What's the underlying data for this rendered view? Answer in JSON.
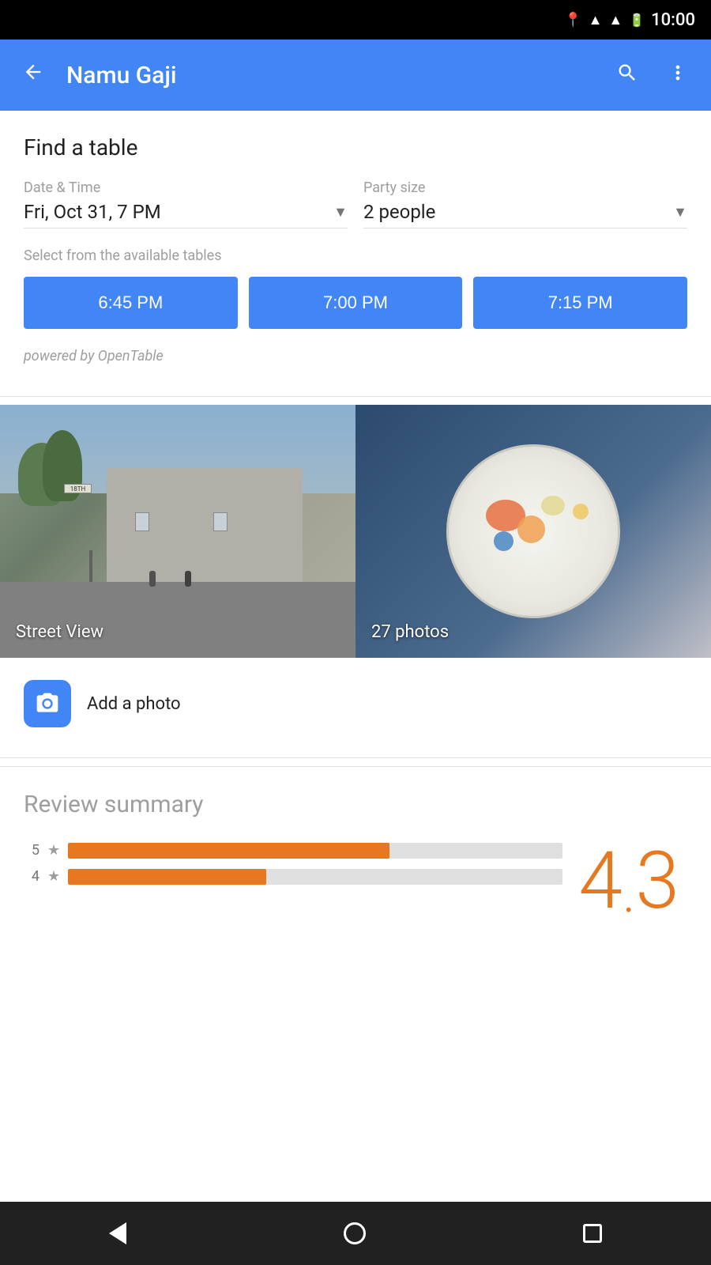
{
  "statusBar": {
    "time": "10:00"
  },
  "appBar": {
    "title": "Namu Gaji",
    "backLabel": "←",
    "searchLabel": "🔍",
    "moreLabel": "⋮"
  },
  "findTable": {
    "title": "Find a table",
    "dateTimeLabel": "Date & Time",
    "dateTimeValue": "Fri, Oct 31, 7 PM",
    "partySizeLabel": "Party size",
    "partySizeValue": "2 people",
    "availableLabel": "Select from the available tables",
    "timeSlots": [
      "6:45 PM",
      "7:00 PM",
      "7:15 PM"
    ],
    "poweredBy": "powered by OpenTable"
  },
  "photos": {
    "streetViewLabel": "Street View",
    "photosLabel": "27 photos",
    "addPhotoLabel": "Add a photo"
  },
  "reviewSummary": {
    "title": "Review summary",
    "rating": "4",
    "ratingDecimal": ".",
    "ratingFraction": "3",
    "bars": [
      {
        "stars": "5",
        "fillPercent": 65
      },
      {
        "stars": "4",
        "fillPercent": 40
      }
    ]
  },
  "bottomNav": {
    "backLabel": "back",
    "homeLabel": "home",
    "recentsLabel": "recents"
  }
}
